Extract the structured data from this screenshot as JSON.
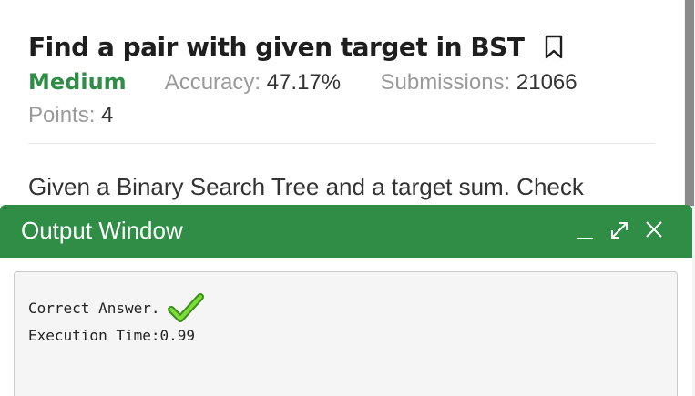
{
  "problem": {
    "title": "Find a pair with given target in BST",
    "difficulty": "Medium",
    "accuracy_label": "Accuracy:",
    "accuracy_value": "47.17%",
    "submissions_label": "Submissions:",
    "submissions_value": "21066",
    "points_label": "Points:",
    "points_value": "4",
    "description": "Given a Binary Search Tree and a target sum. Check"
  },
  "output_window": {
    "title": "Output Window",
    "result_text": "Correct Answer.",
    "execution_time": "Execution Time:0.99"
  },
  "colors": {
    "accent_green": "#2f8d46",
    "check_green": "#5cc21f"
  },
  "icons": [
    "bookmark-icon",
    "minimize-icon",
    "maximize-icon",
    "close-icon",
    "checkmark-icon"
  ]
}
